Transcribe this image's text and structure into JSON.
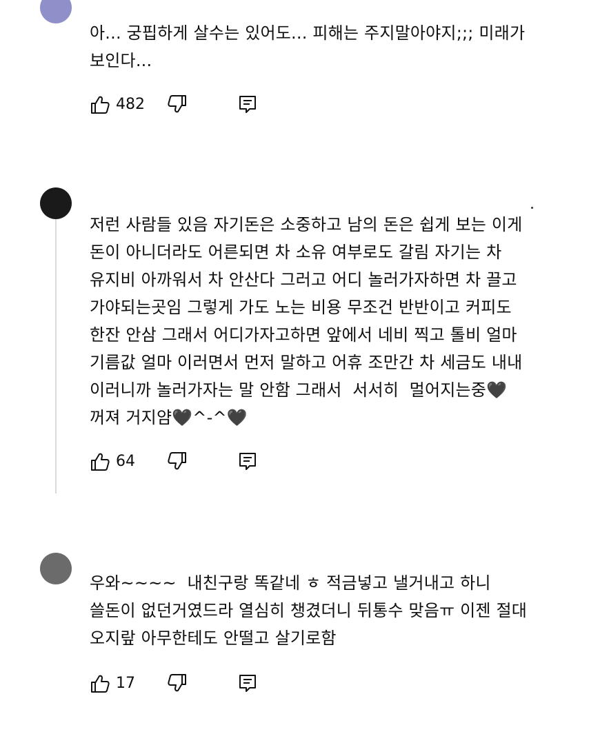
{
  "comments": [
    {
      "text": "아... 궁핍하게 살수는 있어도... 피해는 주지말아야지;;; 미래가 보인다...",
      "likes": "482",
      "avatar_color": "#8f8fc9"
    },
    {
      "text": "저런 사람들 있음 자기돈은 소중하고 남의 돈은 쉽게 보는 이게 돈이 아니더라도 어른되면 차 소유 여부로도 갈림 자기는 차 유지비 아까워서 차 안산다 그러고 어디 놀러가자하면 차 끌고 가야되는곳임 그렇게 가도 노는 비용 무조건 반반이고 커피도 한잔 안삼 그래서 어디가자고하면 앞에서 네비 찍고 톨비 얼마 기름값 얼마 이러면서 먼저 말하고 어휴 조만간 차 세금도 내내 이러니까 놀러가자는 말 안함 그래서  서서히  멀어지는중🖤 꺼져 거지얌🖤^-^🖤",
      "likes": "64",
      "avatar_color": "#1a1a1a"
    },
    {
      "text": "우와~~~~  내친구랑 똑같네 ㅎ 적금넣고 낼거내고 하니 쓸돈이 없던거였드라 열심히 챙겼더니 뒤통수 맞음ㅠ 이젠 절대 오지랖 아무한테도 안떨고 살기로함",
      "likes": "17",
      "avatar_color": "#6b6b6b"
    }
  ],
  "icons": {
    "like": "thumbs-up-icon",
    "dislike": "thumbs-down-icon",
    "reply": "reply-comment-icon"
  }
}
